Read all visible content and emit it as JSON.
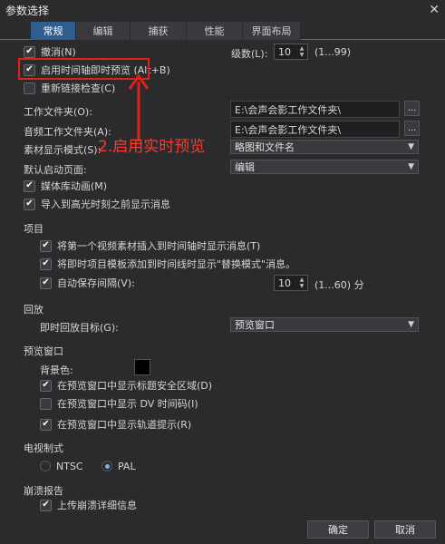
{
  "window": {
    "title": "参数选择",
    "close_label": "✕"
  },
  "tabs": [
    {
      "label": "常规"
    },
    {
      "label": "编辑"
    },
    {
      "label": "捕获"
    },
    {
      "label": "性能"
    },
    {
      "label": "界面布局"
    }
  ],
  "general": {
    "undo_label": "撤消(N)",
    "undo_checked": true,
    "levels_label": "级数(L):",
    "levels_value": "10",
    "levels_range": "(1...99)",
    "timeline_preview_label": "启用时间轴即时预览 (Alt+B)",
    "timeline_preview_checked": true,
    "relink_label": "重新链接检查(C)",
    "relink_checked": false,
    "work_folder_label": "工作文件夹(O):",
    "work_folder_value": "E:\\会声会影工作文件夹\\",
    "audio_folder_label": "音频工作文件夹(A):",
    "audio_folder_value": "E:\\会声会影工作文件夹\\",
    "browse_label": "...",
    "display_mode_label": "素材显示模式(S):",
    "display_mode_value": "略图和文件名",
    "default_page_label": "默认启动页面:",
    "default_page_value": "编辑",
    "media_anim_label": "媒体库动画(M)",
    "media_anim_checked": true,
    "import_highlight_label": "导入到高光时刻之前显示消息",
    "import_highlight_checked": true
  },
  "project": {
    "section_label": "项目",
    "insert_msg_label": "将第一个视频素材插入到时间轴时显示消息(T)",
    "insert_msg_checked": true,
    "replace_msg_label": "将即时项目模板添加到时间线时显示\"替换模式\"消息。",
    "replace_msg_checked": true,
    "autosave_label": "自动保存间隔(V):",
    "autosave_checked": true,
    "autosave_value": "10",
    "autosave_range": "(1...60) 分"
  },
  "playback": {
    "section_label": "回放",
    "target_label": "即时回放目标(G):",
    "target_value": "预览窗口"
  },
  "preview": {
    "section_label": "预览窗口",
    "bg_label": "背景色:",
    "bg_color": "#000000",
    "safe_area_label": "在预览窗口中显示标题安全区域(D)",
    "safe_area_checked": true,
    "dv_timecode_label": "在预览窗口中显示 DV 时间码(I)",
    "dv_timecode_checked": false,
    "track_hint_label": "在预览窗口中显示轨道提示(R)",
    "track_hint_checked": true
  },
  "tv": {
    "section_label": "电视制式",
    "ntsc_label": "NTSC",
    "pal_label": "PAL",
    "selected": "PAL"
  },
  "crash": {
    "section_label": "崩溃报告",
    "upload_label": "上传崩溃详细信息",
    "upload_checked": true
  },
  "annotation": {
    "text": "2.启用实时预览",
    "color": "#e0201a"
  },
  "footer": {
    "ok_label": "确定",
    "cancel_label": "取消"
  },
  "colors": {
    "accent": "#2f5e8e",
    "background": "#2b2b2e"
  }
}
